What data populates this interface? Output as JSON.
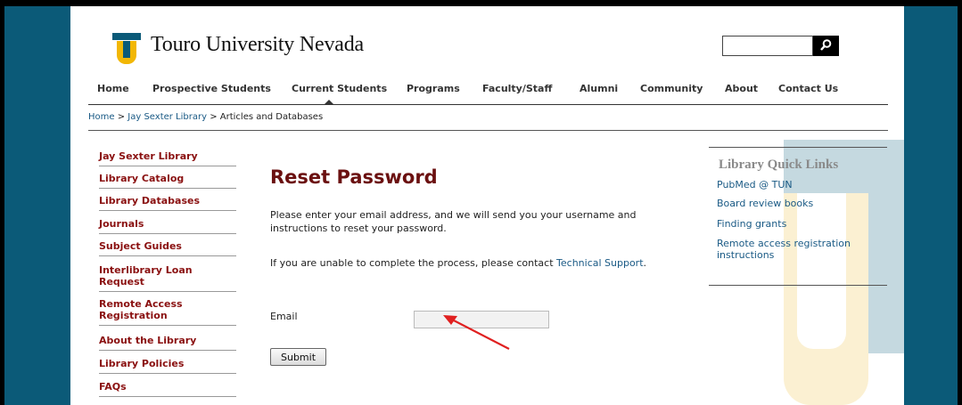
{
  "brand": {
    "name": "Touro University Nevada"
  },
  "search": {
    "placeholder": ""
  },
  "nav": {
    "items": [
      {
        "label": "Home"
      },
      {
        "label": "Prospective Students"
      },
      {
        "label": "Current Students"
      },
      {
        "label": "Programs"
      },
      {
        "label": "Faculty/Staff"
      },
      {
        "label": "Alumni"
      },
      {
        "label": "Community"
      },
      {
        "label": "About"
      },
      {
        "label": "Contact Us"
      }
    ]
  },
  "breadcrumb": {
    "home": "Home",
    "sep1": " > ",
    "library": "Jay Sexter Library",
    "sep2": " > ",
    "current": "Articles and Databases"
  },
  "sidebar": {
    "items": [
      {
        "label": "Jay Sexter Library"
      },
      {
        "label": "Library Catalog"
      },
      {
        "label": "Library Databases"
      },
      {
        "label": "Journals"
      },
      {
        "label": "Subject Guides"
      },
      {
        "label": "Interlibrary Loan Request"
      },
      {
        "label": "Remote Access Registration"
      },
      {
        "label": "About the Library"
      },
      {
        "label": "Library Policies"
      },
      {
        "label": "FAQs"
      }
    ]
  },
  "main": {
    "title": "Reset Password",
    "intro": "Please enter your email address, and we will send you your username and instructions to reset your password.",
    "help_prefix": "If you are unable to complete the process, please contact ",
    "help_link": "Technical Support",
    "help_suffix": ".",
    "email_label": "Email",
    "email_value": "",
    "submit_label": "Submit"
  },
  "quick_links": {
    "title": "Library Quick Links",
    "items": [
      {
        "label": "PubMed @ TUN"
      },
      {
        "label": "Board review books"
      },
      {
        "label": "Finding grants"
      },
      {
        "label": "Remote access registration instructions"
      }
    ]
  },
  "colors": {
    "frame": "#0b5a78",
    "accent_red": "#8a1010",
    "title_red": "#6b1010",
    "link_blue": "#1a5a85",
    "logo_yellow": "#f2b705",
    "annotation_arrow": "#e02020"
  }
}
